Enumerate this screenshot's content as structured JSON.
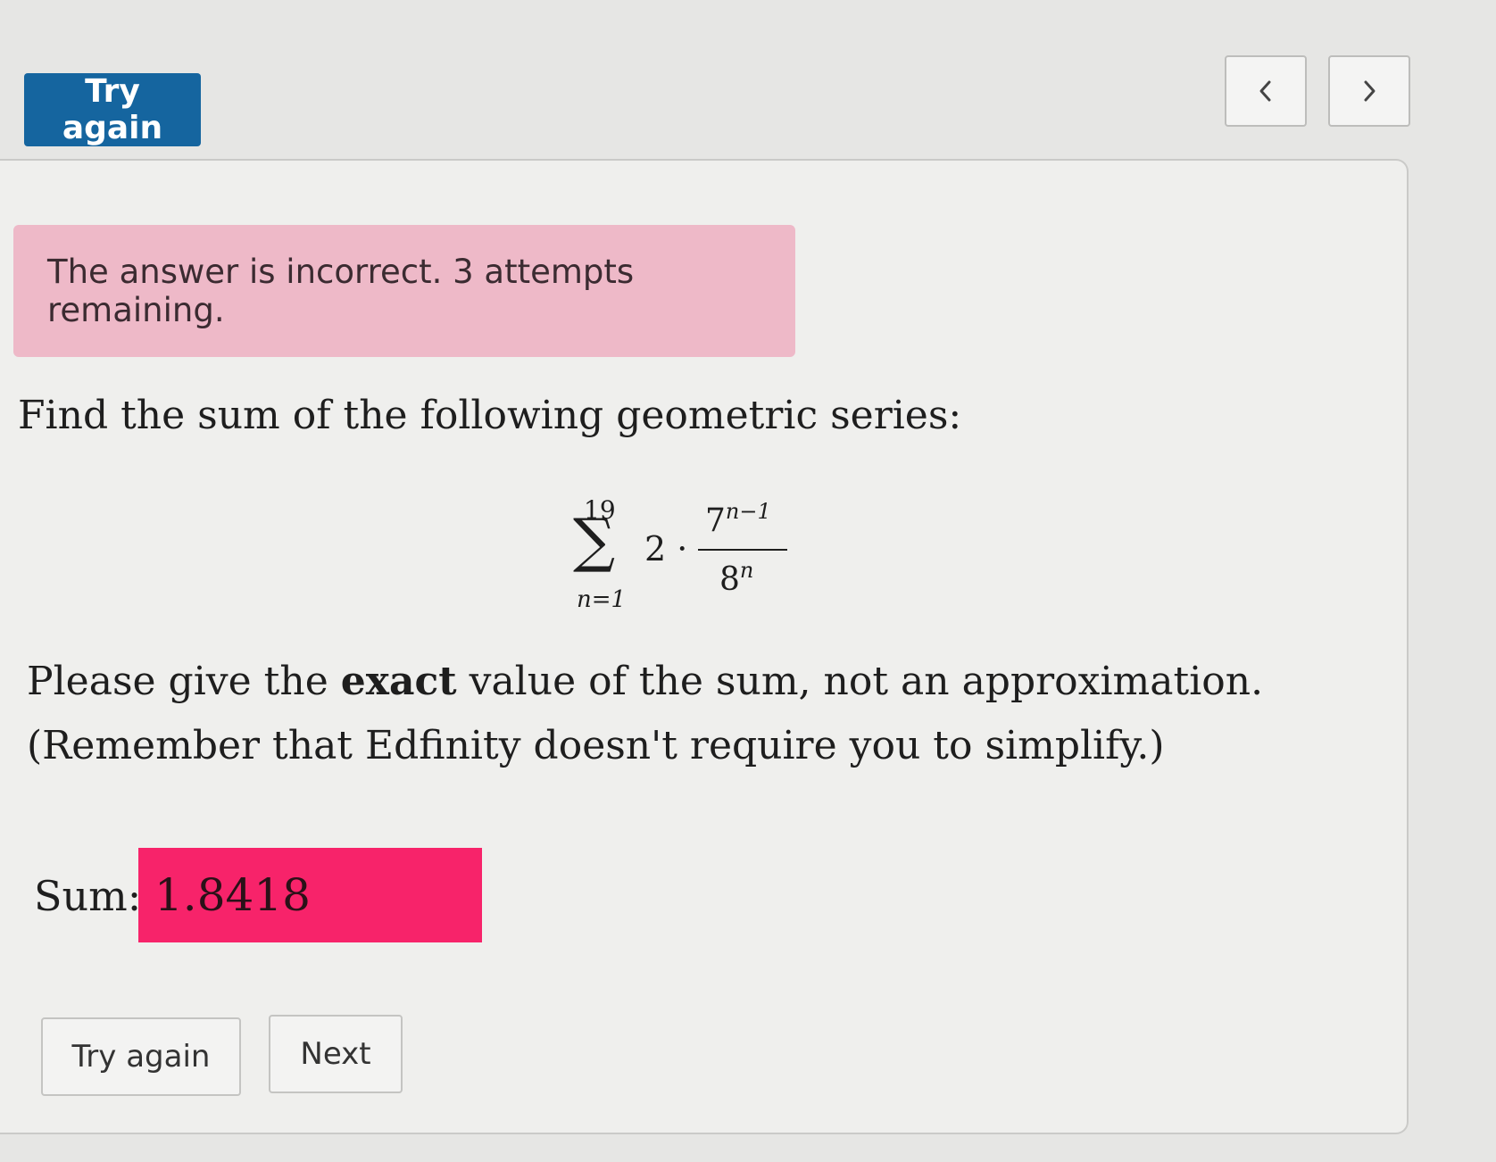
{
  "header": {
    "try_again_label": "Try again"
  },
  "nav": {
    "prev_icon": "chevron-left-icon",
    "next_icon": "chevron-right-icon"
  },
  "alert": {
    "message": "The answer is incorrect. 3 attempts remaining."
  },
  "question": {
    "prompt": "Find the sum of the following geometric series:",
    "formula": {
      "upper_limit": "19",
      "lower_limit": "n=1",
      "coefficient": "2 ·",
      "numerator_base": "7",
      "numerator_exponent": "n−1",
      "denominator_base": "8",
      "denominator_exponent": "n"
    },
    "instruction_before": "Please give the ",
    "instruction_bold": "exact",
    "instruction_after": " value of the sum, not an approximation. (Remember that Edfinity doesn't require you to simplify.)"
  },
  "answer": {
    "label": "Sum:",
    "value": "1.8418"
  },
  "actions": {
    "try_again_label": "Try again",
    "next_label": "Next"
  },
  "colors": {
    "primary": "#15659f",
    "alert_bg": "#eeb9c8",
    "incorrect_input": "#f7236a"
  }
}
